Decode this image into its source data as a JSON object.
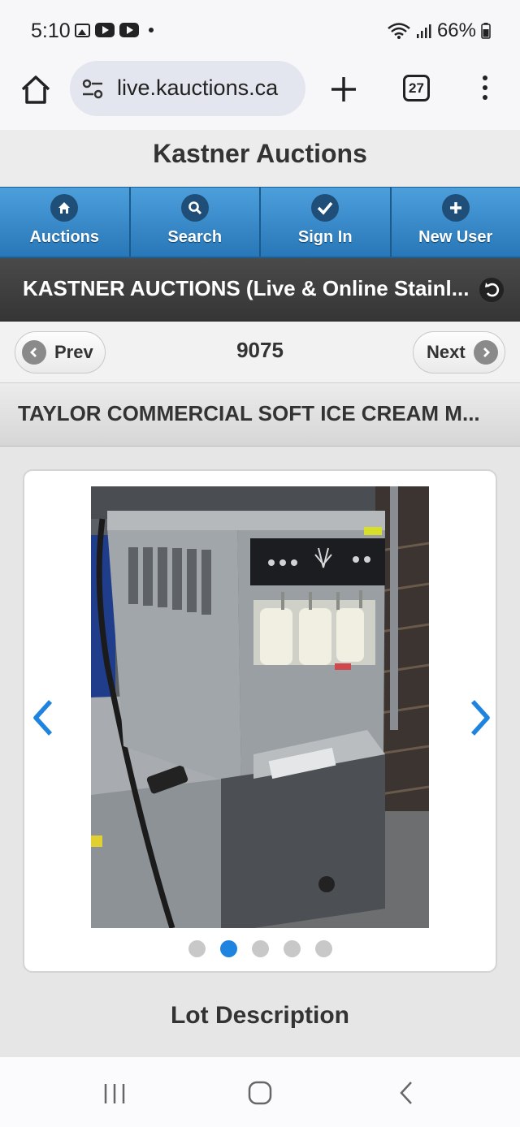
{
  "status_bar": {
    "time": "5:10",
    "battery": "66%"
  },
  "browser": {
    "url": "live.kauctions.ca",
    "tab_count": "27"
  },
  "site": {
    "title": "Kastner Auctions"
  },
  "nav": [
    {
      "label": "Auctions",
      "icon": "home-icon"
    },
    {
      "label": "Search",
      "icon": "search-icon"
    },
    {
      "label": "Sign In",
      "icon": "check-icon"
    },
    {
      "label": "New User",
      "icon": "plus-icon"
    }
  ],
  "auction_title": "KASTNER AUCTIONS (Live & Online Stainl...",
  "pager": {
    "prev_label": "Prev",
    "next_label": "Next",
    "lot_number": "9075"
  },
  "item_title": "TAYLOR COMMERCIAL SOFT ICE CREAM M...",
  "gallery": {
    "photo_count": 5,
    "active_index": 1
  },
  "section": {
    "lot_description_heading": "Lot Description"
  },
  "colors": {
    "nav_blue": "#2c7fc0",
    "dark_bar": "#3d3d3d",
    "active_dot": "#1f84e0",
    "carousel_arrow": "#1f84e0"
  }
}
